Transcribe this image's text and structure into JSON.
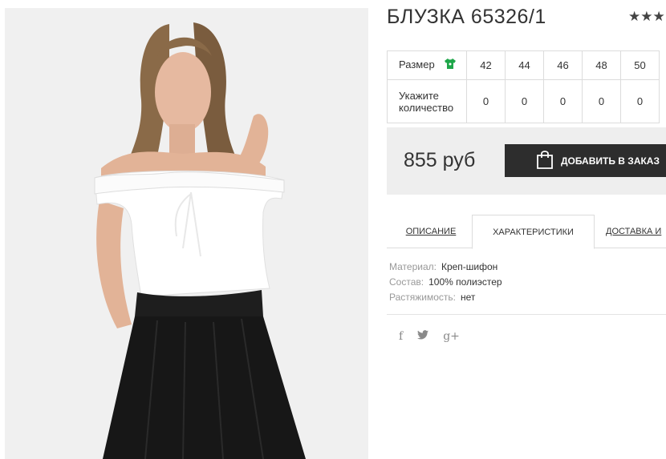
{
  "product": {
    "title": "БЛУЗКА 65326/1",
    "rating_stars": "★★★"
  },
  "sizes": {
    "size_label": "Размер",
    "qty_label_line1": "Укажите",
    "qty_label_line2": "количество",
    "columns": [
      "42",
      "44",
      "46",
      "48",
      "50"
    ],
    "quantities": [
      "0",
      "0",
      "0",
      "0",
      "0"
    ],
    "shirt_icon_color": "#1fa64a"
  },
  "purchase": {
    "price": "855 руб",
    "add_button_label": "ДОБАВИТЬ В ЗАКАЗ"
  },
  "tabs": [
    {
      "label": "ОПИСАНИЕ"
    },
    {
      "label": "ХАРАКТЕРИСТИКИ"
    },
    {
      "label": "ДОСТАВКА И"
    }
  ],
  "specs": [
    {
      "key": "Материал:",
      "value": "Креп-шифон"
    },
    {
      "key": "Состав:",
      "value": "100% полиэстер"
    },
    {
      "key": "Растяжимость:",
      "value": "нет"
    }
  ],
  "social": {
    "facebook_glyph": "f",
    "twitter_glyph": "🐦",
    "gplus_glyph": "g+"
  },
  "colors": {
    "button_bg": "#2d2d2d",
    "price_box_bg": "#eeeeee",
    "border": "#dcdcdc"
  }
}
